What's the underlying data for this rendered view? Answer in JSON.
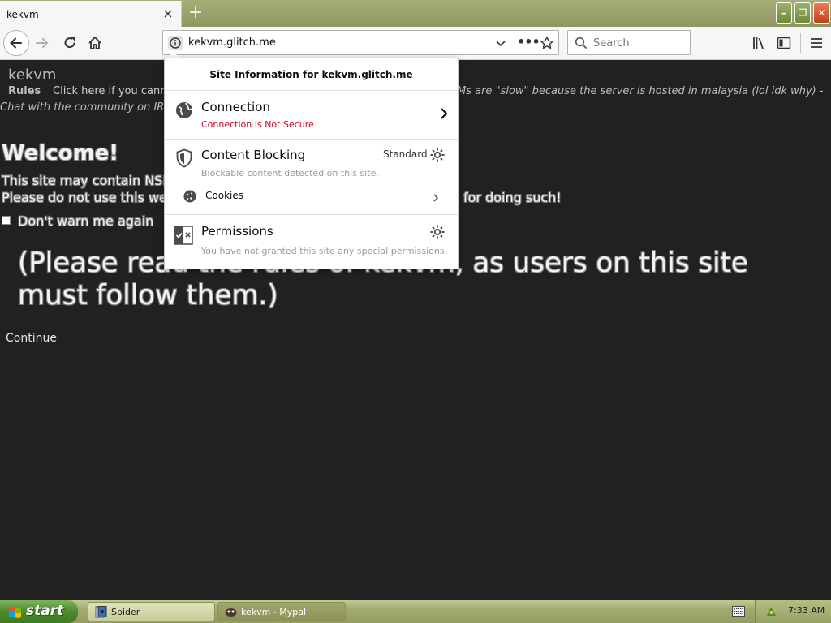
{
  "browser": {
    "tab": {
      "title": "kekvm",
      "close_glyph": "×"
    },
    "new_tab_glyph": "+",
    "url": "kekvm.glitch.me",
    "search_placeholder": "Search",
    "page_actions_glyph": "•••"
  },
  "page": {
    "site_name": "kekvm",
    "rules_label": "Rules",
    "topline": "Click here if you canno",
    "topline_italic": "Ms are \"slow\" because the server is hosted in malaysia (lol idk why) -",
    "irc_line": "Chat with the community on IRC",
    "welcome": "Welcome!",
    "warn_line1": "This site may contain NSF",
    "warn_line2": "Please do not use this we",
    "warn_line2_end": "for doing such!",
    "dont_warn_label": "Don't warn me again",
    "big_note": "(Please read the rules of kekvm, as users on this site must follow them.)",
    "continue_label": "Continue"
  },
  "popup": {
    "header": "Site Information for kekvm.glitch.me",
    "connection": {
      "title": "Connection",
      "status": "Connection Is Not Secure"
    },
    "content_blocking": {
      "title": "Content Blocking",
      "mode": "Standard",
      "desc": "Blockable content detected on this site.",
      "cookies_label": "Cookies"
    },
    "permissions": {
      "title": "Permissions",
      "desc": "You have not granted this site any special permissions."
    }
  },
  "taskbar": {
    "start_label": "start",
    "tasks": [
      {
        "label": "Spider",
        "icon": "spider-solitaire-icon"
      },
      {
        "label": "kekvm - Mypal",
        "icon": "mypal-icon"
      }
    ],
    "clock": "7:33 AM"
  },
  "colors": {
    "page_bg": "#212121",
    "insecure_red": "#d70022",
    "taskbar_olive": "#a3aa6e",
    "start_green": "#4c8a2c"
  }
}
